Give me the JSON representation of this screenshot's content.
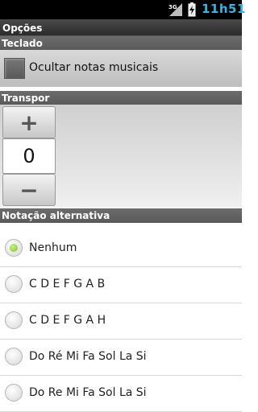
{
  "status_bar": {
    "network": "3G",
    "signal_icon": "signal-icon",
    "battery_icon": "battery-charging-icon",
    "time": "11h51",
    "time_color": "#33b5e5"
  },
  "screen": {
    "title": "Opções"
  },
  "sections": {
    "keyboard": {
      "header": "Teclado",
      "checkbox_label": "Ocultar notas musicais",
      "checkbox_checked": false
    },
    "transpose": {
      "header": "Transpor",
      "plus_label": "+",
      "value": "0",
      "minus_label": "−"
    },
    "notation": {
      "header": "Notação alternativa",
      "options": [
        {
          "label": "Nenhum",
          "selected": true
        },
        {
          "label": "C D E F G A B",
          "selected": false
        },
        {
          "label": "C D E F G A H",
          "selected": false
        },
        {
          "label": "Do Ré Mi Fa Sol La Si",
          "selected": false
        },
        {
          "label": "Do Re Mi Fa Sol La Si",
          "selected": false
        }
      ]
    }
  }
}
